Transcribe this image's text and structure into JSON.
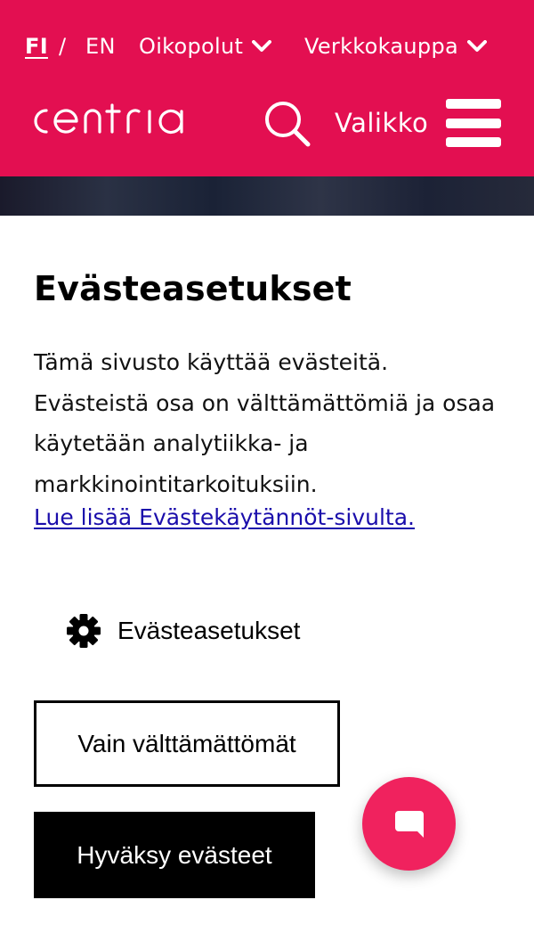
{
  "header": {
    "lang_fi": "FI",
    "lang_sep": "/",
    "lang_en": "EN",
    "shortcuts_label": "Oikopolut",
    "shop_label": "Verkkokauppa",
    "logo_text": "centria",
    "search_icon": "search-icon",
    "menu_label": "Valikko",
    "menu_icon": "hamburger-icon",
    "brand_color": "#e30f51"
  },
  "cookie_panel": {
    "title": "Evästeasetukset",
    "body": "Tämä sivusto käyttää evästeitä. Evästeistä osa on välttämättömiä ja osaa käytetään analytiikka- ja markkinointitarkoituksiin.",
    "read_more": "Lue lisää Evästekäytännöt-sivulta.",
    "settings_label": "Evästeasetukset",
    "settings_icon": "gear-icon",
    "necessary_only_button": "Vain välttämättömät",
    "accept_button": "Hyväksy evästeet"
  },
  "chat": {
    "icon": "chat-bubble-icon",
    "color": "#f0225e"
  }
}
